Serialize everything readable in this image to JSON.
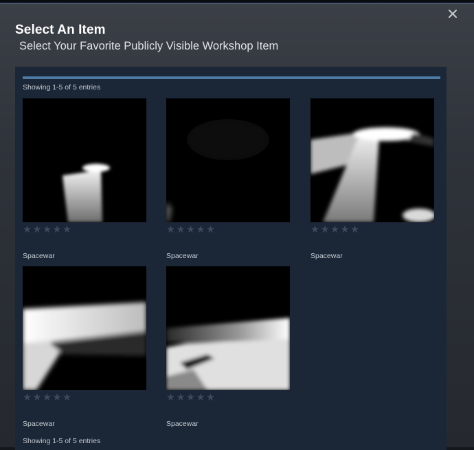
{
  "dialog": {
    "title": "Select An Item",
    "subtitle": "Select Your Favorite Publicly Visible Workshop Item",
    "close_icon": "close-icon"
  },
  "listing": {
    "count_top": "Showing 1-5 of 5 entries",
    "count_bottom": "Showing 1-5 of 5 entries"
  },
  "items": [
    {
      "name": "Spacewar",
      "rating_stars": 0,
      "star_glyph": "★"
    },
    {
      "name": "Spacewar",
      "rating_stars": 0,
      "star_glyph": "★"
    },
    {
      "name": "Spacewar",
      "rating_stars": 0,
      "star_glyph": "★"
    },
    {
      "name": "Spacewar",
      "rating_stars": 0,
      "star_glyph": "★"
    },
    {
      "name": "Spacewar",
      "rating_stars": 0,
      "star_glyph": "★"
    }
  ],
  "colors": {
    "accent": "#4d7aa6",
    "panel": "#1b2636",
    "star_empty": "#3c4a5c"
  }
}
